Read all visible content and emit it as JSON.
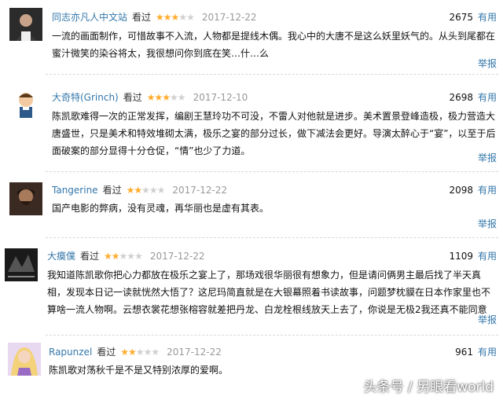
{
  "reviews": [
    {
      "user": "同志亦凡人中文站",
      "seen": "看过",
      "rating": 3,
      "date": "2017-12-22",
      "votes": "2675",
      "useful": "有用",
      "lines": [
        "一流的画面制作，可惜故事不入流，人物都是提线木偶。我心中的大唐不是这么妖里妖气的。从头到尾都在",
        "蜜汁微笑的染谷将太，我很想问你到底在笑…什…么"
      ],
      "report": "举报"
    },
    {
      "user": "大奇特(Grinch)",
      "seen": "看过",
      "rating": 3,
      "date": "2017-12-10",
      "votes": "2698",
      "useful": "有用",
      "lines": [
        "陈凯歌难得一次的正常发挥，编剧王慧玲功不可没，不雷人对他就是进步。美术置景登峰造极，极力营造大",
        "唐盛世，只是美术和特效堆砌太满，极乐之宴的部分过长，做下减法会更好。导演太醉心于“宴”，以至于后",
        "面破案的部分显得十分仓促，“情”也少了力道。"
      ],
      "report": "举报"
    },
    {
      "user": "Tangerine",
      "seen": "看过",
      "rating": 2,
      "date": "2017-12-22",
      "votes": "2098",
      "useful": "有用",
      "lines": [
        "国产电影的弊病，没有灵魂，再华丽也是虚有其表。"
      ],
      "report": "举报"
    },
    {
      "user": "大瘼僕",
      "seen": "看过",
      "rating": 2,
      "date": "2017-12-22",
      "votes": "1109",
      "useful": "有用",
      "lines": [
        "我知道陈凯歌你把心力都放在极乐之宴上了，那场戏很华丽很有想象力，但是请问俩男主最后找了半天真",
        "相，发现本日记一读就恍然大悟了？这尼玛简直就是在大银幕照着书读故事，问题梦枕貘在日本作家里也不",
        "算啥一流人物啊。云想衣裳花想张榕容就差把丹龙、白龙栓根线放天上去了，你说是无极2我还真不能同意"
      ],
      "report": "举报"
    },
    {
      "user": "Rapunzel",
      "seen": "看过",
      "rating": 2,
      "date": "2017-12-22",
      "votes": "961",
      "useful": "有用",
      "lines": [
        "陈凯歌对荡秋千是不是又特别浓厚的爱啊。"
      ],
      "report": ""
    }
  ],
  "watermark": "头条号 / 另眼看world"
}
